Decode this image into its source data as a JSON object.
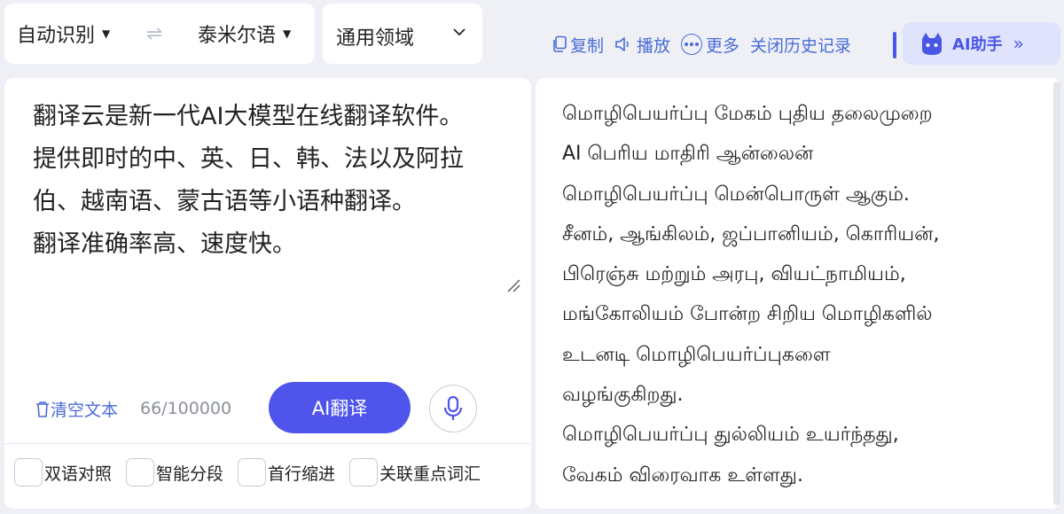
{
  "source_lang": "自动识别",
  "target_lang": "泰米尔语",
  "domain": "通用领域",
  "toolbar": {
    "copy": "复制",
    "play": "播放",
    "more": "更多",
    "history": "关闭历史记录",
    "ai_assistant": "AI助手"
  },
  "source_text": [
    "翻译云是新一代AI大模型在线翻译软件。",
    "提供即时的中、英、日、韩、法以及阿拉",
    "伯、越南语、蒙古语等小语种翻译。",
    "翻译准确率高、速度快。"
  ],
  "clear_label": "清空文本",
  "char_count": "66/100000",
  "translate_button": "AI翻译",
  "options": [
    "双语对照",
    "智能分段",
    "首行缩进",
    "关联重点词汇"
  ],
  "output_text": [
    "மொழிபெயர்ப்பு மேகம் புதிய தலைமுறை",
    "AI பெரிய மாதிரி ஆன்லைன்",
    "மொழிபெயர்ப்பு மென்பொருள் ஆகும்.",
    "சீனம், ஆங்கிலம், ஜப்பானியம், கொரியன்,",
    "பிரெஞ்சு மற்றும் அரபு, வியட்நாமியம்,",
    "மங்கோலியம் போன்ற சிறிய மொழிகளில்",
    "உடனடி மொழிபெயர்ப்புகளை",
    "வழங்குகிறது.",
    "மொழிபெயர்ப்பு துல்லியம் உயர்ந்தது,",
    "வேகம் விரைவாக உள்ளது."
  ],
  "colors": {
    "accent": "#4f54ea",
    "link": "#4a6cd6",
    "background": "#eef0f6"
  }
}
